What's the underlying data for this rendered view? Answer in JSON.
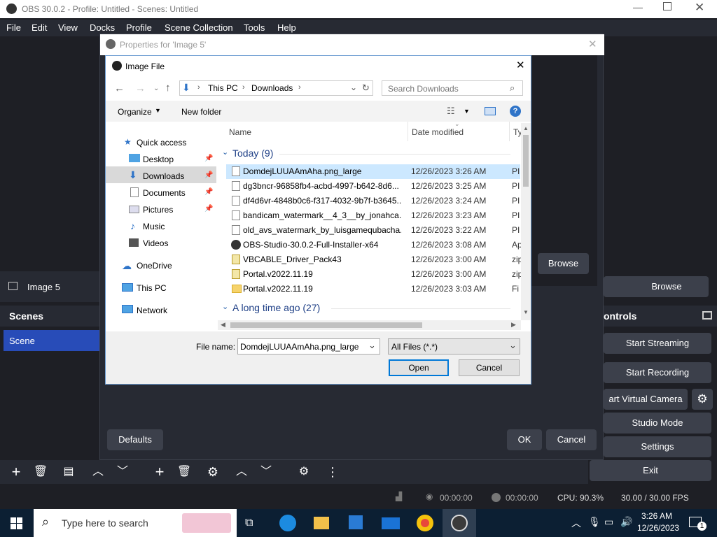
{
  "obs": {
    "window_title": "OBS 30.0.2 - Profile: Untitled - Scenes: Untitled",
    "menu": [
      "File",
      "Edit",
      "View",
      "Docks",
      "Profile",
      "Scene Collection",
      "Tools",
      "Help"
    ],
    "source_bar_label": "Image 5",
    "browse_label": "Browse",
    "scenes_header": "Scenes",
    "scene_item": "Scene",
    "controls_header": "ontrols",
    "controls": [
      "Start Streaming",
      "Start Recording",
      "art Virtual Camera",
      "Studio Mode",
      "Settings",
      "Exit"
    ],
    "status": {
      "stream_time": "00:00:00",
      "rec_time": "00:00:00",
      "cpu": "CPU: 90.3%",
      "fps": "30.00 / 30.00 FPS"
    }
  },
  "properties": {
    "title": "Properties for 'Image 5'",
    "browse_label": "Browse",
    "defaults_label": "Defaults",
    "ok_label": "OK",
    "cancel_label": "Cancel"
  },
  "file_dialog": {
    "title": "Image File",
    "breadcrumb": [
      "This PC",
      "Downloads"
    ],
    "search_placeholder": "Search Downloads",
    "organize_label": "Organize",
    "new_folder_label": "New folder",
    "columns": {
      "name": "Name",
      "date": "Date modified",
      "type": "Ty"
    },
    "group_today": "Today (9)",
    "group_long": "A long time ago (27)",
    "nav": [
      "Quick access",
      "Desktop",
      "Downloads",
      "Documents",
      "Pictures",
      "Music",
      "Videos",
      "OneDrive",
      "This PC",
      "Network"
    ],
    "files": [
      {
        "name": "DomdejLUUAAmAha.png_large",
        "date": "12/26/2023 3:26 AM",
        "type": "PI"
      },
      {
        "name": "dg3bncr-96858fb4-acbd-4997-b642-8d6...",
        "date": "12/26/2023 3:25 AM",
        "type": "PI"
      },
      {
        "name": "df4d6vr-4848b0c6-f317-4032-9b7f-b3645...",
        "date": "12/26/2023 3:24 AM",
        "type": "PI"
      },
      {
        "name": "bandicam_watermark__4_3__by_jonahca...",
        "date": "12/26/2023 3:23 AM",
        "type": "PI"
      },
      {
        "name": "old_avs_watermark_by_luisgamequbacha...",
        "date": "12/26/2023 3:22 AM",
        "type": "PI"
      },
      {
        "name": "OBS-Studio-30.0.2-Full-Installer-x64",
        "date": "12/26/2023 3:08 AM",
        "type": "Ap"
      },
      {
        "name": "VBCABLE_Driver_Pack43",
        "date": "12/26/2023 3:00 AM",
        "type": "zip"
      },
      {
        "name": "Portal.v2022.11.19",
        "date": "12/26/2023 3:00 AM",
        "type": "zip"
      },
      {
        "name": "Portal.v2022.11.19",
        "date": "12/26/2023 3:03 AM",
        "type": "Fi"
      }
    ],
    "file_name_label": "File name:",
    "file_name_value": "DomdejLUUAAmAha.png_large",
    "filter_value": "All Files (*.*)",
    "open_label": "Open",
    "cancel_label": "Cancel"
  },
  "taskbar": {
    "search_placeholder": "Type here to search",
    "time": "3:26 AM",
    "date": "12/26/2023",
    "notification_count": "1"
  }
}
